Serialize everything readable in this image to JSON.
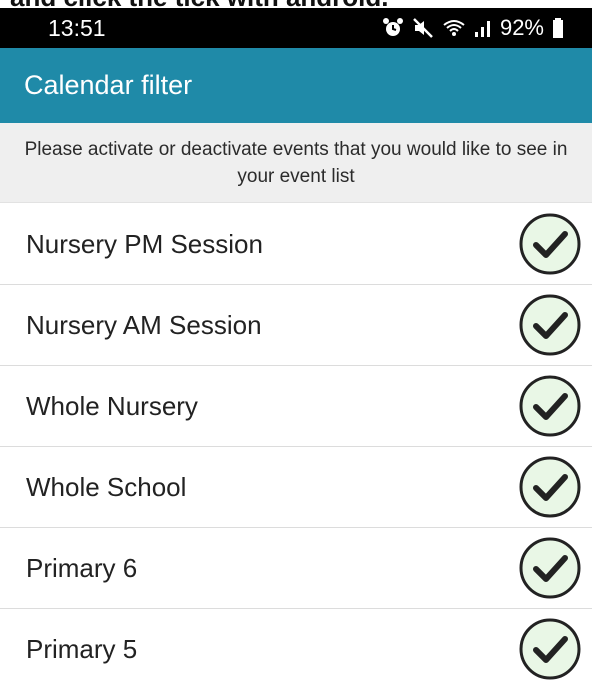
{
  "caption": "and click the tick with android.",
  "status_bar": {
    "time": "13:51",
    "battery": "92%",
    "icons": [
      "alarm-icon",
      "mute-icon",
      "wifi-icon",
      "signal-icon",
      "battery-icon"
    ]
  },
  "app_bar": {
    "title": "Calendar filter",
    "color": "#1f8aa8"
  },
  "notice": {
    "text": "Please activate or deactivate events that you would like to see in your event list"
  },
  "events": [
    {
      "label": "Nursery PM Session",
      "active": true
    },
    {
      "label": "Nursery AM Session",
      "active": true
    },
    {
      "label": "Whole Nursery",
      "active": true
    },
    {
      "label": "Whole School",
      "active": true
    },
    {
      "label": "Primary 6",
      "active": true
    },
    {
      "label": "Primary 5",
      "active": true
    }
  ],
  "colors": {
    "check_fill": "#e9f7e6",
    "check_stroke": "#222222"
  }
}
